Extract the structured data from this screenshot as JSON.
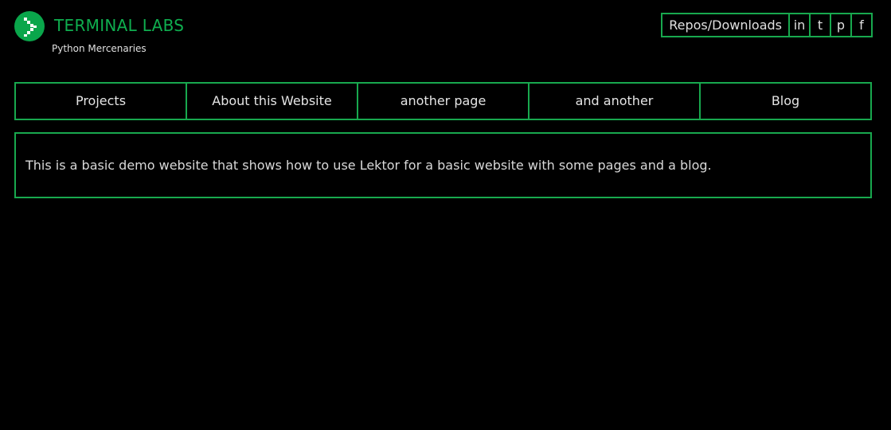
{
  "brand": {
    "title": "TERMINAL LABS",
    "tagline": "Python Mercenaries",
    "logo_icon": "chevron-right-icon",
    "accent_color": "#0fae4f"
  },
  "top_links": {
    "repos": "Repos/Downloads",
    "social": [
      {
        "label": "in",
        "icon": "linkedin"
      },
      {
        "label": "t",
        "icon": "twitter"
      },
      {
        "label": "p",
        "icon": "pinterest"
      },
      {
        "label": "f",
        "icon": "facebook"
      }
    ]
  },
  "nav": {
    "items": [
      {
        "label": "Projects"
      },
      {
        "label": "About this Website"
      },
      {
        "label": "another page"
      },
      {
        "label": "and another"
      },
      {
        "label": "Blog"
      }
    ]
  },
  "main": {
    "intro": "This is a basic demo website that shows how to use Lektor for a basic website with some pages and a blog."
  },
  "colors": {
    "background": "#000000",
    "border": "#18a84e",
    "text": "#d8d8d8"
  }
}
